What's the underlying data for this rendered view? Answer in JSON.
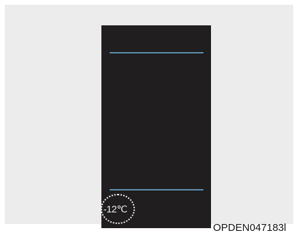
{
  "display": {
    "outside_temperature": "-12℃"
  },
  "figure": {
    "code": "OPDEN047183l"
  }
}
